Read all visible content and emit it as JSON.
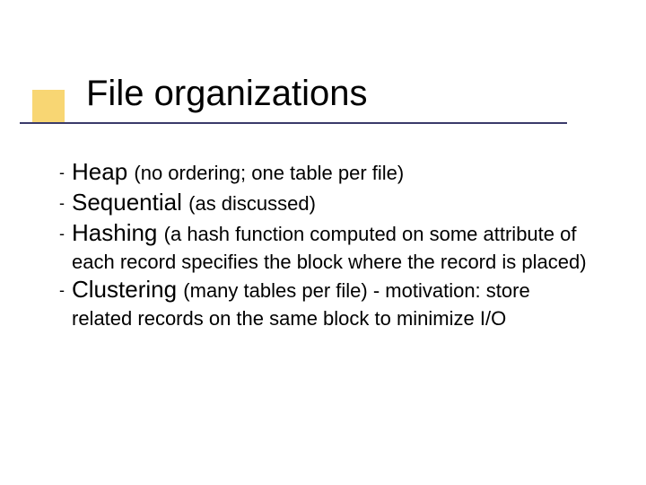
{
  "title": "File organizations",
  "bullet": "-",
  "items": [
    {
      "name": "Heap",
      "open": "(",
      "note": "no ordering; one table per file",
      "close": ")"
    },
    {
      "name": "Sequential",
      "open": "(",
      "note": "as discussed",
      "close": ")"
    },
    {
      "name": "Hashing",
      "open": "(",
      "note": "a hash function computed on some attribute of each record specifies the block where the record is placed",
      "close": ")"
    },
    {
      "name": "Clustering",
      "open": "(",
      "note": "many tables per file",
      "close": ")",
      "dash": " - ",
      "tail": "motivation: store related records on the same block to minimize I/O"
    }
  ]
}
